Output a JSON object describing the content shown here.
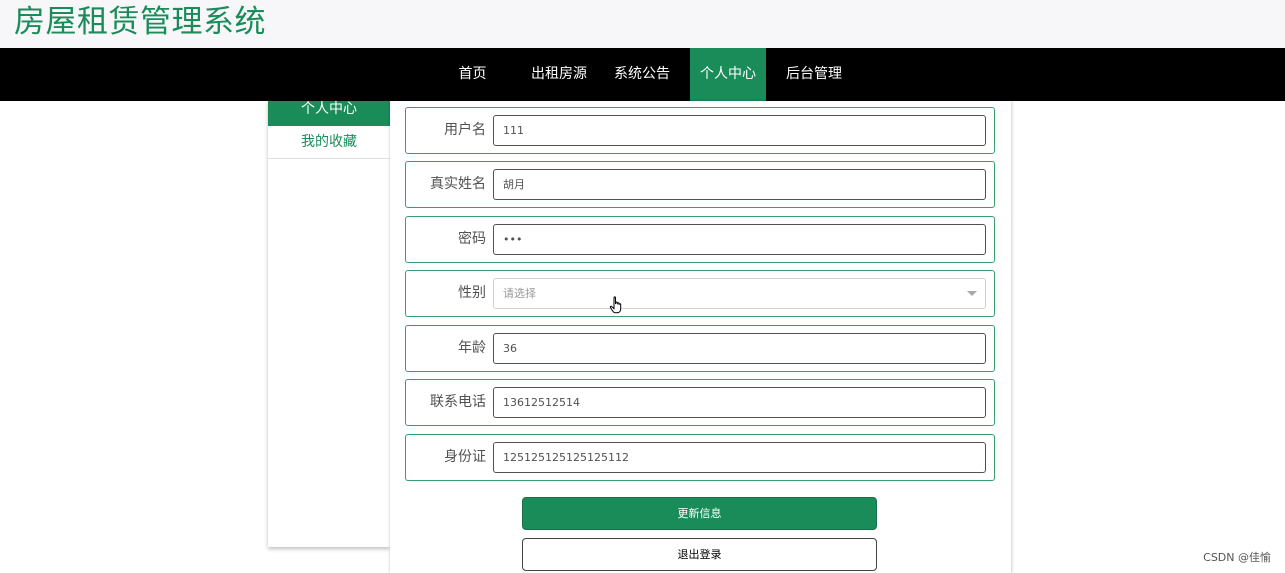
{
  "header": {
    "title": "房屋租赁管理系统"
  },
  "nav": {
    "items": [
      {
        "label": "首页"
      },
      {
        "label": "出租房源"
      },
      {
        "label": "系统公告"
      },
      {
        "label": "个人中心"
      },
      {
        "label": "后台管理"
      }
    ],
    "active": "个人中心"
  },
  "sidebar": {
    "items": [
      {
        "label": "个人中心"
      },
      {
        "label": "我的收藏"
      }
    ]
  },
  "form": {
    "fields": [
      {
        "label": "用户名",
        "value": "111"
      },
      {
        "label": "真实姓名",
        "value": "胡月"
      },
      {
        "label": "密码",
        "value": "•••"
      },
      {
        "label": "性别",
        "placeholder": "请选择"
      },
      {
        "label": "年龄",
        "value": "36"
      },
      {
        "label": "联系电话",
        "value": "13612512514"
      },
      {
        "label": "身份证",
        "value": "125125125125125112"
      }
    ],
    "update_button": "更新信息",
    "logout_button": "退出登录"
  },
  "watermark": "CSDN @佳愉",
  "colors": {
    "accent": "#1a8c5a",
    "nav_bg": "#000000"
  }
}
